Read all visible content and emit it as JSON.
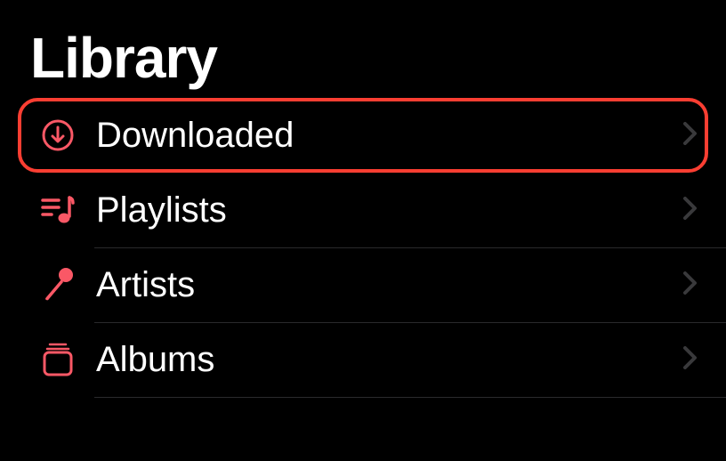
{
  "header": {
    "title": "Library"
  },
  "items": [
    {
      "label": "Downloaded",
      "icon": "download-icon",
      "highlighted": true
    },
    {
      "label": "Playlists",
      "icon": "playlist-icon",
      "highlighted": false
    },
    {
      "label": "Artists",
      "icon": "microphone-icon",
      "highlighted": false
    },
    {
      "label": "Albums",
      "icon": "albums-icon",
      "highlighted": false
    }
  ],
  "colors": {
    "accent": "#fa5866",
    "highlight": "#fa3e32"
  }
}
